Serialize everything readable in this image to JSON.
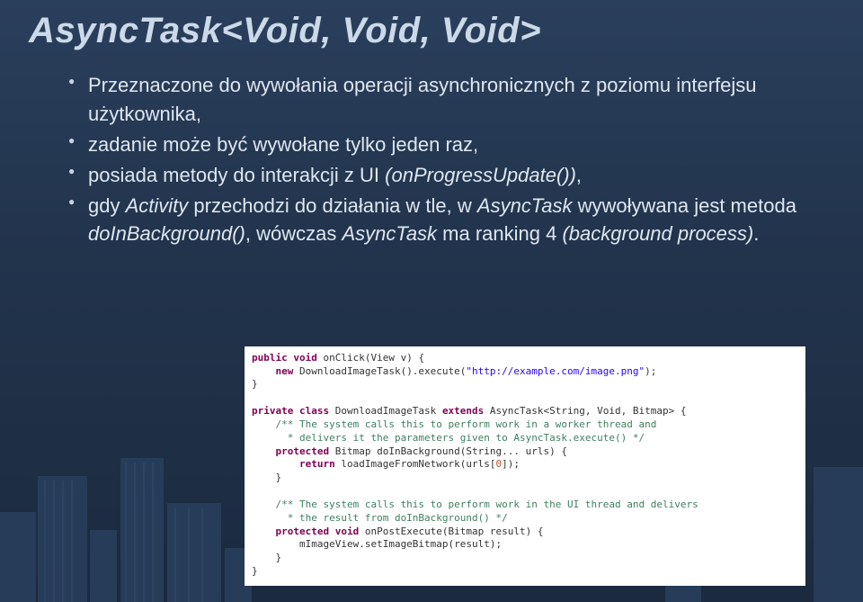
{
  "title": "AsyncTask<Void, Void, Void>",
  "bullets": {
    "b1": "Przeznaczone do wywołania operacji asynchronicznych z poziomu interfejsu użytkownika,",
    "b2": "zadanie może być wywołane tylko jeden raz,",
    "b3_pre": "posiada metody do interakcji z UI ",
    "b3_em": "(onProgressUpdate())",
    "b3_post": ",",
    "b4_pre": "gdy ",
    "b4_em1": "Activity",
    "b4_mid1": " przechodzi do działania w tle, w ",
    "b4_em2": "AsyncTask",
    "b4_mid2": " wywoływana jest metoda ",
    "b4_em3": "doInBackground()",
    "b4_mid3": ", wówczas ",
    "b4_em4": "AsyncTask",
    "b4_mid4": " ma ranking 4 ",
    "b4_em5": "(background process)",
    "b4_post": "."
  },
  "code": {
    "l1a": "public void",
    "l1b": " onClick(View v) {",
    "l2a": "    new",
    "l2b": " DownloadImageTask().execute(",
    "l2c": "\"http://example.com/image.png\"",
    "l2d": ");",
    "l3": "}",
    "l4": "",
    "l5a": "private class",
    "l5b": " DownloadImageTask ",
    "l5c": "extends",
    "l5d": " AsyncTask<String, Void, Bitmap> {",
    "l6": "    /** The system calls this to perform work in a worker thread and",
    "l7": "      * delivers it the parameters given to AsyncTask.execute() */",
    "l8a": "    protected",
    "l8b": " Bitmap doInBackground(String... urls) {",
    "l9a": "        return",
    "l9b": " loadImageFromNetwork(urls[",
    "l9c": "0",
    "l9d": "]);",
    "l10": "    }",
    "l11": "",
    "l12": "    /** The system calls this to perform work in the UI thread and delivers",
    "l13": "      * the result from doInBackground() */",
    "l14a": "    protected void",
    "l14b": " onPostExecute(Bitmap result) {",
    "l15": "        mImageView.setImageBitmap(result);",
    "l16": "    }",
    "l17": "}"
  }
}
